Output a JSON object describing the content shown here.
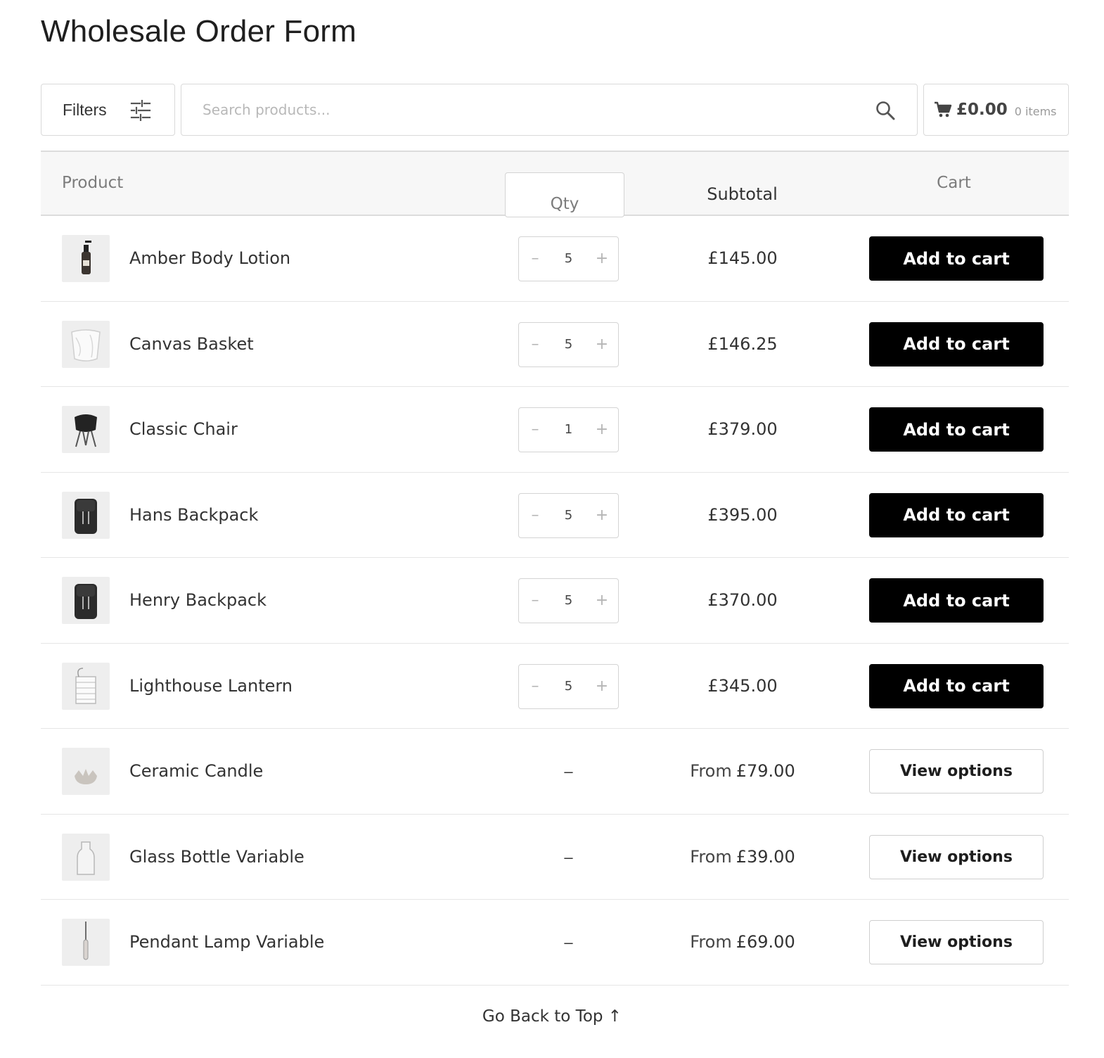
{
  "page": {
    "title": "Wholesale Order Form"
  },
  "toolbar": {
    "filters_label": "Filters",
    "search_placeholder": "Search products...",
    "cart_total": "£0.00",
    "cart_count": "0 items"
  },
  "table": {
    "headers": {
      "product": "Product",
      "qty": "Qty",
      "subtotal": "Subtotal",
      "cart": "Cart"
    },
    "rows": [
      {
        "name": "Amber Body Lotion",
        "qty": "5",
        "subtotal": "£145.00",
        "subtotal_prefix": "",
        "action": "Add to cart",
        "thumb_icon": "lotion-bottle-icon"
      },
      {
        "name": "Canvas Basket",
        "qty": "5",
        "subtotal": "£146.25",
        "subtotal_prefix": "",
        "action": "Add to cart",
        "thumb_icon": "basket-icon"
      },
      {
        "name": "Classic Chair",
        "qty": "1",
        "subtotal": "£379.00",
        "subtotal_prefix": "",
        "action": "Add to cart",
        "thumb_icon": "chair-icon"
      },
      {
        "name": "Hans Backpack",
        "qty": "5",
        "subtotal": "£395.00",
        "subtotal_prefix": "",
        "action": "Add to cart",
        "thumb_icon": "backpack-icon"
      },
      {
        "name": "Henry Backpack",
        "qty": "5",
        "subtotal": "£370.00",
        "subtotal_prefix": "",
        "action": "Add to cart",
        "thumb_icon": "backpack-icon"
      },
      {
        "name": "Lighthouse Lantern",
        "qty": "5",
        "subtotal": "£345.00",
        "subtotal_prefix": "",
        "action": "Add to cart",
        "thumb_icon": "lantern-icon"
      },
      {
        "name": "Ceramic Candle",
        "qty": "–",
        "subtotal": "£79.00",
        "subtotal_prefix": "From",
        "action": "View options",
        "thumb_icon": "candle-icon"
      },
      {
        "name": "Glass Bottle Variable",
        "qty": "–",
        "subtotal": "£39.00",
        "subtotal_prefix": "From",
        "action": "View options",
        "thumb_icon": "glass-bottle-icon"
      },
      {
        "name": "Pendant Lamp Variable",
        "qty": "–",
        "subtotal": "£69.00",
        "subtotal_prefix": "From",
        "action": "View options",
        "thumb_icon": "pendant-lamp-icon"
      }
    ],
    "qty_minus": "–",
    "qty_plus": "+"
  },
  "footer": {
    "back_to_top": "Go Back to Top ↑"
  },
  "colors": {
    "add_button_bg": "#000000",
    "view_button_border": "#cfcfcf",
    "header_bg": "#f7f7f7"
  }
}
